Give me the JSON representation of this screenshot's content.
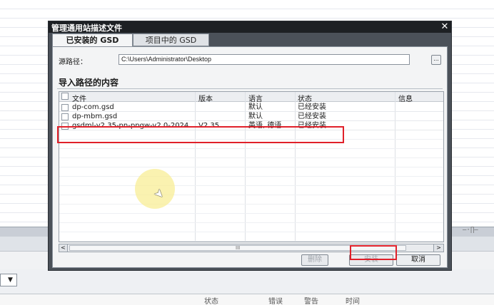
{
  "dialog": {
    "title": "管理通用站描述文件",
    "close_label": "✕",
    "tabs": [
      {
        "label": "已安装的 GSD",
        "active": true
      },
      {
        "label": "项目中的 GSD",
        "active": false
      }
    ],
    "source_path": {
      "label": "源路径：",
      "value": "C:\\Users\\Administrator\\Desktop",
      "browse_label": "..."
    },
    "section_title": "导入路径的内容",
    "table": {
      "columns": [
        "文件",
        "版本",
        "语言",
        "状态",
        "信息"
      ],
      "rows": [
        {
          "file": "dp-com.gsd",
          "version": "",
          "language": "默认",
          "status": "已经安装",
          "info": "",
          "checked": false
        },
        {
          "file": "dp-mbm.gsd",
          "version": "",
          "language": "默认",
          "status": "已经安装",
          "info": "",
          "checked": false
        },
        {
          "file": "gsdml-v2.35-pn-pngw-v2.0-2024...",
          "version": "V2.35",
          "language": "英语, 德语",
          "status": "已经安装",
          "info": "",
          "checked": false
        }
      ]
    },
    "scrollbar": {
      "left_arrow": "<",
      "right_arrow": ">",
      "grip": "III"
    },
    "buttons": {
      "delete": "删除",
      "install": "安装",
      "cancel": "取消"
    }
  },
  "background": {
    "dropdown_arrow": "▼",
    "right_control": "—·∏—",
    "bottom_columns": [
      "状态",
      "错误",
      "警告",
      "时间"
    ]
  },
  "colors": {
    "highlight": "#e0202a",
    "title_bar": "#1d2024",
    "dialog_frame": "#4b5159",
    "cursor_halo": "#f8ee96"
  },
  "icons": [
    "close-icon",
    "browse-icon",
    "checkbox-icon",
    "mouse-cursor-icon"
  ]
}
